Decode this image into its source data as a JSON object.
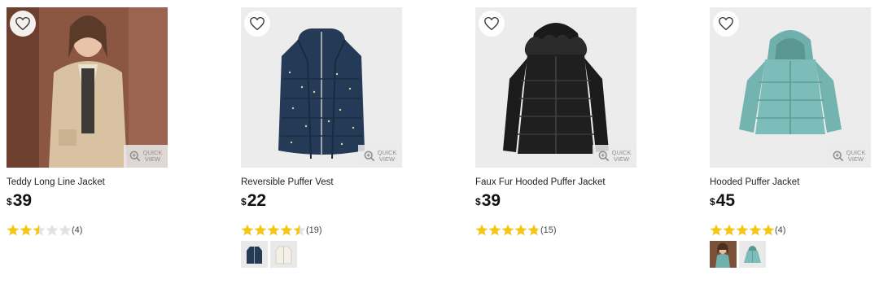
{
  "products": [
    {
      "title": "Teddy Long Line Jacket",
      "currency": "$",
      "price": "39",
      "rating": 2.5,
      "review_count": "(4)",
      "quick_view_label": "QUICK VIEW",
      "image": "teddy-long-line-jacket",
      "swatches": []
    },
    {
      "title": "Reversible Puffer Vest",
      "currency": "$",
      "price": "22",
      "rating": 4.5,
      "review_count": "(19)",
      "quick_view_label": "QUICK VIEW",
      "image": "reversible-puffer-vest",
      "swatches": [
        "navy-vest",
        "cream-vest"
      ]
    },
    {
      "title": "Faux Fur Hooded Puffer Jacket",
      "currency": "$",
      "price": "39",
      "rating": 4.8,
      "review_count": "(15)",
      "quick_view_label": "QUICK VIEW",
      "image": "faux-fur-hooded-puffer-jacket",
      "swatches": []
    },
    {
      "title": "Hooded Puffer Jacket",
      "currency": "$",
      "price": "45",
      "rating": 5,
      "review_count": "(4)",
      "quick_view_label": "QUICK VIEW",
      "image": "hooded-puffer-jacket",
      "swatches": [
        "model-photo",
        "teal-jacket"
      ]
    }
  ],
  "colors": {
    "star_filled": "#f5c518",
    "star_empty": "#e2e2e2",
    "price_text": "#111111"
  },
  "icons": {
    "wishlist": "heart-outline-icon",
    "quick_view": "magnify-plus-icon",
    "rating": "star-icon"
  }
}
